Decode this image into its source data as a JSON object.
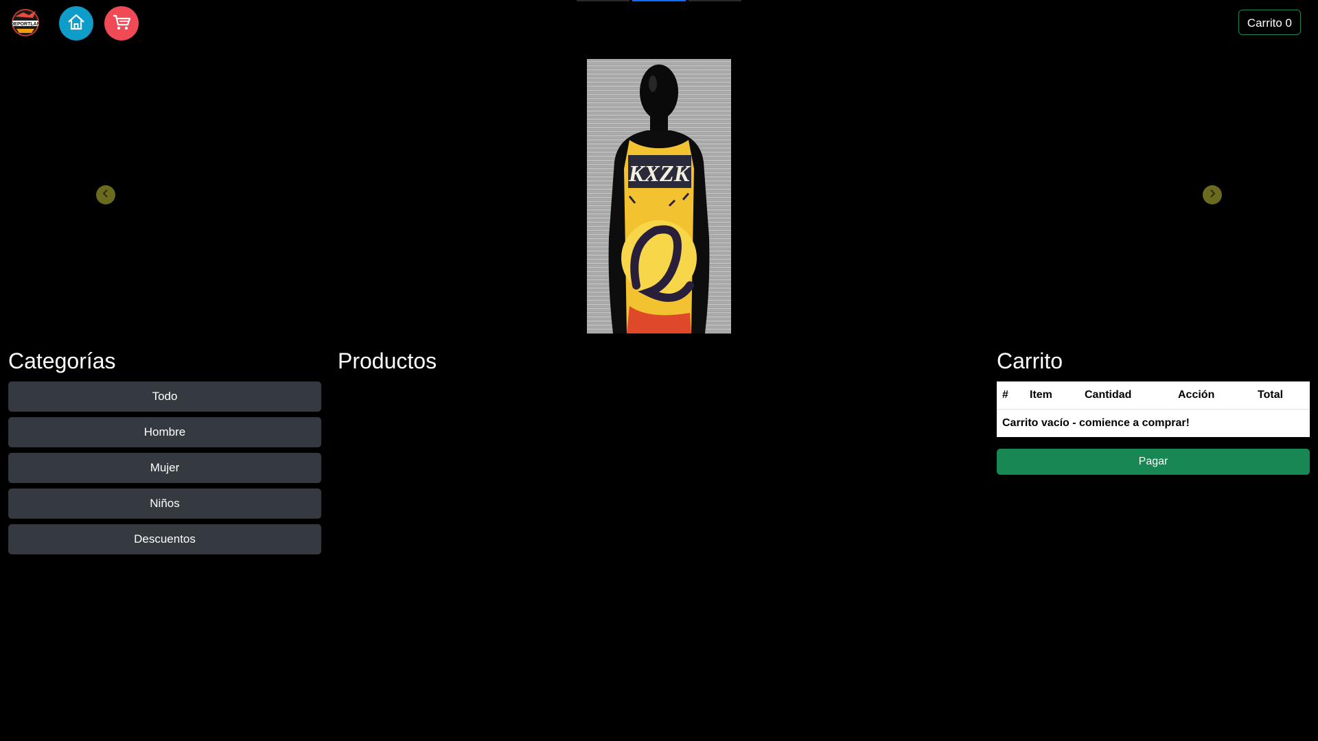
{
  "header": {
    "logo_text": "DEPORTLAN",
    "cart_button_label": "Carrito 0"
  },
  "carousel": {
    "slide_text": "KXZK"
  },
  "categories": {
    "title": "Categorías",
    "items": [
      {
        "label": "Todo"
      },
      {
        "label": "Hombre"
      },
      {
        "label": "Mujer"
      },
      {
        "label": "Niños"
      },
      {
        "label": "Descuentos"
      }
    ]
  },
  "products": {
    "title": "Productos"
  },
  "cart": {
    "title": "Carrito",
    "columns": [
      "#",
      "Item",
      "Cantidad",
      "Acción",
      "Total"
    ],
    "empty_message": "Carrito vacío - comience a comprar!",
    "pay_label": "Pagar"
  },
  "colors": {
    "background": "#000000",
    "home_button": "#0e9cc9",
    "cart_icon_button": "#ef4a56",
    "category_button": "#343a40",
    "pay_button": "#198754"
  },
  "icons": [
    "logo-icon",
    "home-icon",
    "shopping-cart-icon",
    "chevron-left-icon",
    "chevron-right-icon"
  ]
}
